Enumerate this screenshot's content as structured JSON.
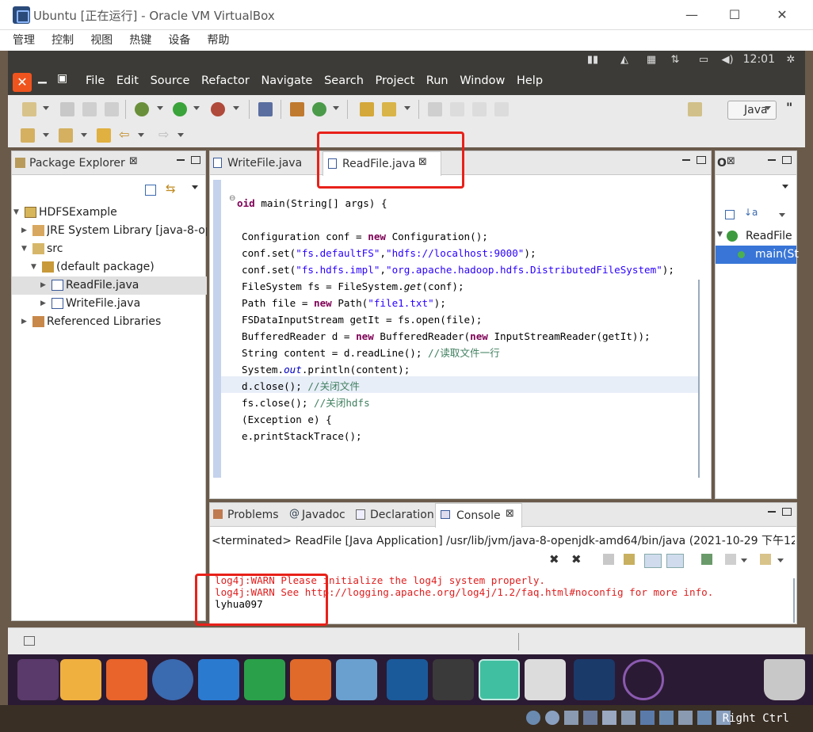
{
  "vbox": {
    "title": "Ubuntu [正在运行] - Oracle VM VirtualBox",
    "menu": [
      "管理",
      "控制",
      "视图",
      "热键",
      "设备",
      "帮助"
    ],
    "status_right": "Right Ctrl"
  },
  "panel": {
    "clock": "12:01"
  },
  "eclipse": {
    "menu": [
      "File",
      "Edit",
      "Source",
      "Refactor",
      "Navigate",
      "Search",
      "Project",
      "Run",
      "Window",
      "Help"
    ],
    "perspective": "Java",
    "perspective_overflow": "\""
  },
  "package_explorer": {
    "tab": "Package Explorer",
    "tree": [
      {
        "label": "HDFSExample"
      },
      {
        "label": "JRE System Library [java-8-op"
      },
      {
        "label": "src"
      },
      {
        "label": "(default package)"
      },
      {
        "label": "ReadFile.java"
      },
      {
        "label": "WriteFile.java"
      },
      {
        "label": "Referenced Libraries"
      }
    ]
  },
  "editor": {
    "tabs": [
      "WriteFile.java",
      "ReadFile.java"
    ],
    "lines": {
      "l1a": "oid",
      "l1b": " main(String[] args) {",
      "l3a": "Configuration conf = ",
      "l3b": "new",
      "l3c": " Configuration();",
      "l4a": "conf.set(",
      "l4b": "\"fs.defaultFS\"",
      "l4c": ",",
      "l4d": "\"hdfs://localhost:9000\"",
      "l4e": ");",
      "l5a": "conf.set(",
      "l5b": "\"fs.hdfs.impl\"",
      "l5c": ",",
      "l5d": "\"org.apache.hadoop.hdfs.DistributedFileSystem\"",
      "l5e": ");",
      "l6a": "FileSystem fs = FileSystem.",
      "l6b": "get",
      "l6c": "(conf);",
      "l7a": "Path file = ",
      "l7b": "new",
      "l7c": " Path(",
      "l7d": "\"file1.txt\"",
      "l7e": ");",
      "l8": "FSDataInputStream getIt = fs.open(file);",
      "l9a": "BufferedReader d = ",
      "l9b": "new",
      "l9c": " BufferedReader(",
      "l9d": "new",
      "l9e": " InputStreamReader(getIt));",
      "l10a": "String content = d.readLine(); ",
      "l10b": "//读取文件一行",
      "l11a": "System.",
      "l11b": "out",
      "l11c": ".println(content);",
      "l12a": "d.close(); ",
      "l12b": "//关闭文件",
      "l13a": "fs.close(); ",
      "l13b": "//关闭hdfs",
      "l14": "(Exception e) {",
      "l15": "e.printStackTrace();"
    }
  },
  "outline": {
    "tab": "O",
    "class": "ReadFile",
    "method": "main(St"
  },
  "console": {
    "tabs": [
      "Problems",
      "Javadoc",
      "Declaration",
      "Console"
    ],
    "header": "<terminated> ReadFile [Java Application] /usr/lib/jvm/java-8-openjdk-amd64/bin/java (2021-10-29 下午12:01:",
    "out": [
      "log4j:WARN Please initialize the log4j system properly.",
      "log4j:WARN See http://logging.apache.org/log4j/1.2/faq.html#noconfig for more info.",
      "lyhua097"
    ]
  },
  "colors": {
    "highlight": "#e8211a",
    "keyword": "#7f0055",
    "string": "#2a00ff",
    "comment": "#3f7f5f",
    "console_err": "#e02020"
  }
}
